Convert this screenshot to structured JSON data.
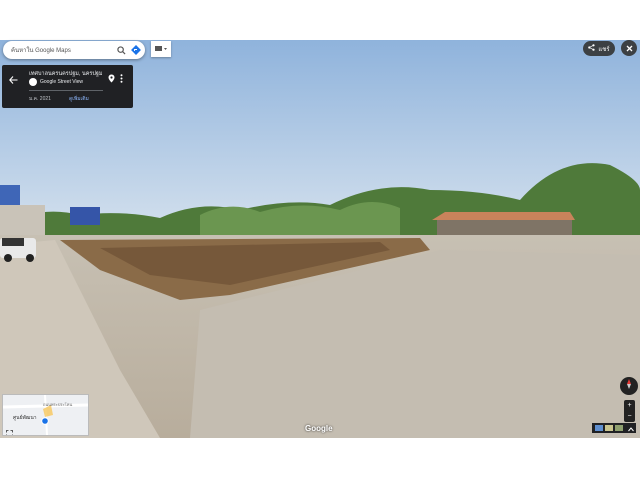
{
  "search": {
    "placeholder": "ค้นหาใน Google Maps"
  },
  "info_card": {
    "title": "เทศบาลนครนครปฐม, นครปฐม",
    "source": "Google Street View",
    "date": "ม.ค. 2021",
    "more_link": "ดูเพิ่มเติม"
  },
  "share": {
    "label": "แชร์"
  },
  "minimap": {
    "place_label": "ศูนย์พัฒนา",
    "road_label": "ถนนพระประโทน"
  },
  "attribution": {
    "label": "Google"
  },
  "zoom": {
    "plus": "+",
    "minus": "−"
  },
  "icons": {
    "search": "search-icon",
    "directions": "directions-icon",
    "layers": "layers-icon",
    "back": "back-arrow-icon",
    "pin": "map-pin-icon",
    "more": "more-vert-icon",
    "share": "share-icon",
    "close": "close-icon",
    "compass": "compass-icon",
    "expand": "expand-icon",
    "pegman": "pegman-icon"
  },
  "colors": {
    "accent": "#1a73e8",
    "card_bg": "#202124",
    "link": "#8ab4f8",
    "sky": "#a9c6e6",
    "dirt": "#8a6b48"
  }
}
